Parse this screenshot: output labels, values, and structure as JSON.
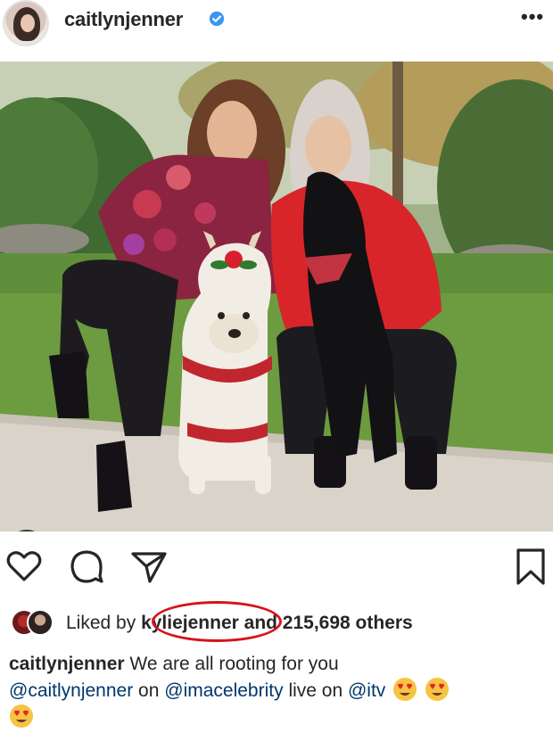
{
  "header": {
    "avatar_icon": "profile-avatar",
    "username": "caitlynjenner",
    "verified_icon": "verified-badge-icon",
    "more_label": "•••"
  },
  "photo": {
    "user_tag_icon": "person-icon"
  },
  "actions": {
    "like_icon": "heart-icon",
    "comment_icon": "comment-icon",
    "share_icon": "send-icon",
    "save_icon": "bookmark-icon"
  },
  "likes": {
    "prefix": "Liked by ",
    "liker": "kyliejenner",
    "suffix": "and 215,698 others"
  },
  "caption": {
    "username": "caitlynjenner",
    "text1": " We are all rooting for you",
    "mention1": "@caitlynjenner",
    "text2": " on ",
    "mention2": "@imacelebrity",
    "text3": " live on ",
    "mention3": "@itv",
    "emoji_icon": "heart-eyes-emoji"
  },
  "colors": {
    "verified": "#3897f0",
    "mention": "#00376b",
    "highlight_circle": "#d6121b"
  }
}
